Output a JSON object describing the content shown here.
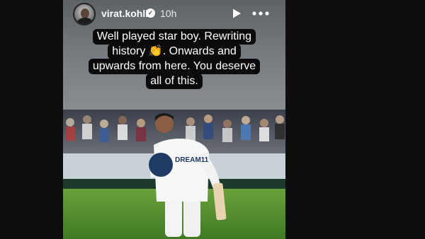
{
  "story": {
    "username": "virat.kohli",
    "verified_icon": "verified-badge-icon",
    "time": "10h",
    "play_icon": "play-icon",
    "more_icon": "more-options-icon",
    "caption_lines": [
      "Well played star boy. Rewriting",
      "history 👏. Onwards and",
      "upwards from here. You deserve",
      "all of this."
    ],
    "photo": {
      "jersey_text": "DREAM11"
    }
  },
  "colors": {
    "background": "#0e0e10",
    "caption_bg": "#0b0b0b",
    "grass": "#4f8a2e"
  }
}
